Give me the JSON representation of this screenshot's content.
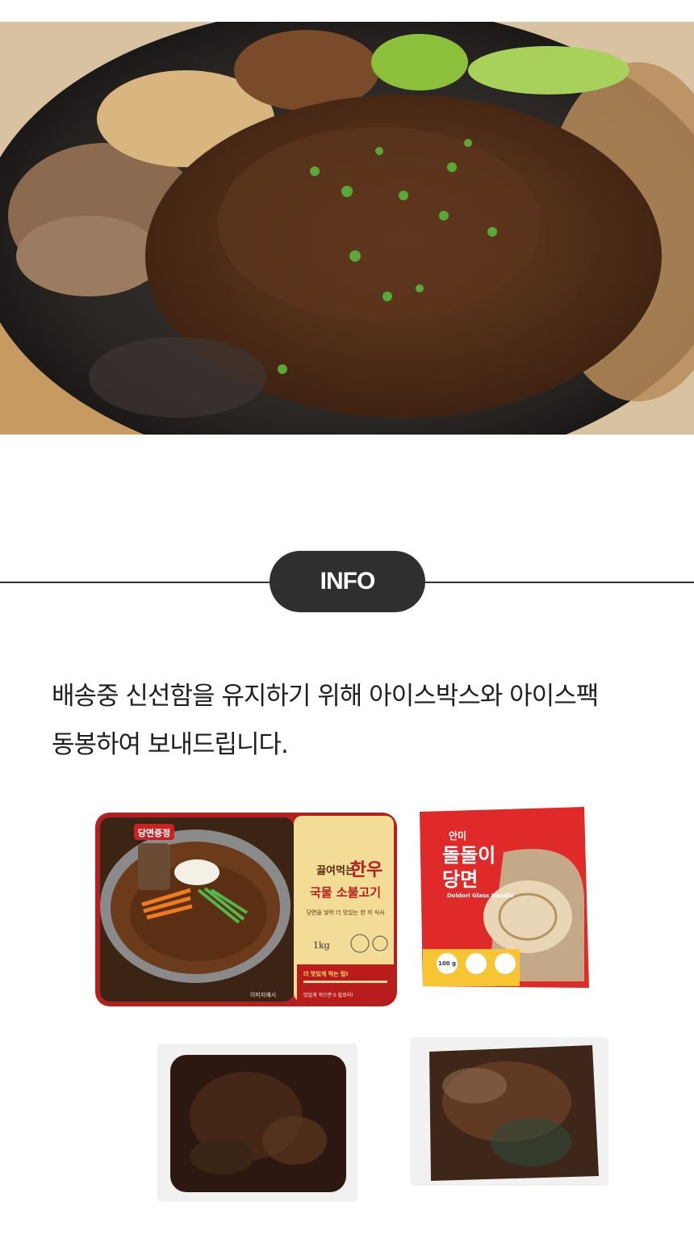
{
  "hero": {
    "image": "bulgogi-dish-photo"
  },
  "info": {
    "label": "INFO"
  },
  "description": {
    "line1": "배송중 신선함을 유지하기 위해 아이스박스와 아이스팩",
    "line2": "동봉하여 보내드립니다."
  },
  "products": {
    "tray": {
      "badge": "당면증정",
      "brand_small": "끓여먹는",
      "brand_big": "한우",
      "name_line": "국물 소불고기",
      "sub": "당면을 넣어 더 맛있는 한 끼 식사",
      "weight": "1kg",
      "tip_title": "더 맛있게 먹는 팁!",
      "tip_bottom": "맛있게 먹으면 0 칼로리!",
      "footer": "이미지예시"
    },
    "noodle": {
      "brand": "안미",
      "title1": "돌돌이",
      "title2": "당면",
      "english": "Doldori Glass Noodle",
      "amount": "100 g"
    }
  }
}
